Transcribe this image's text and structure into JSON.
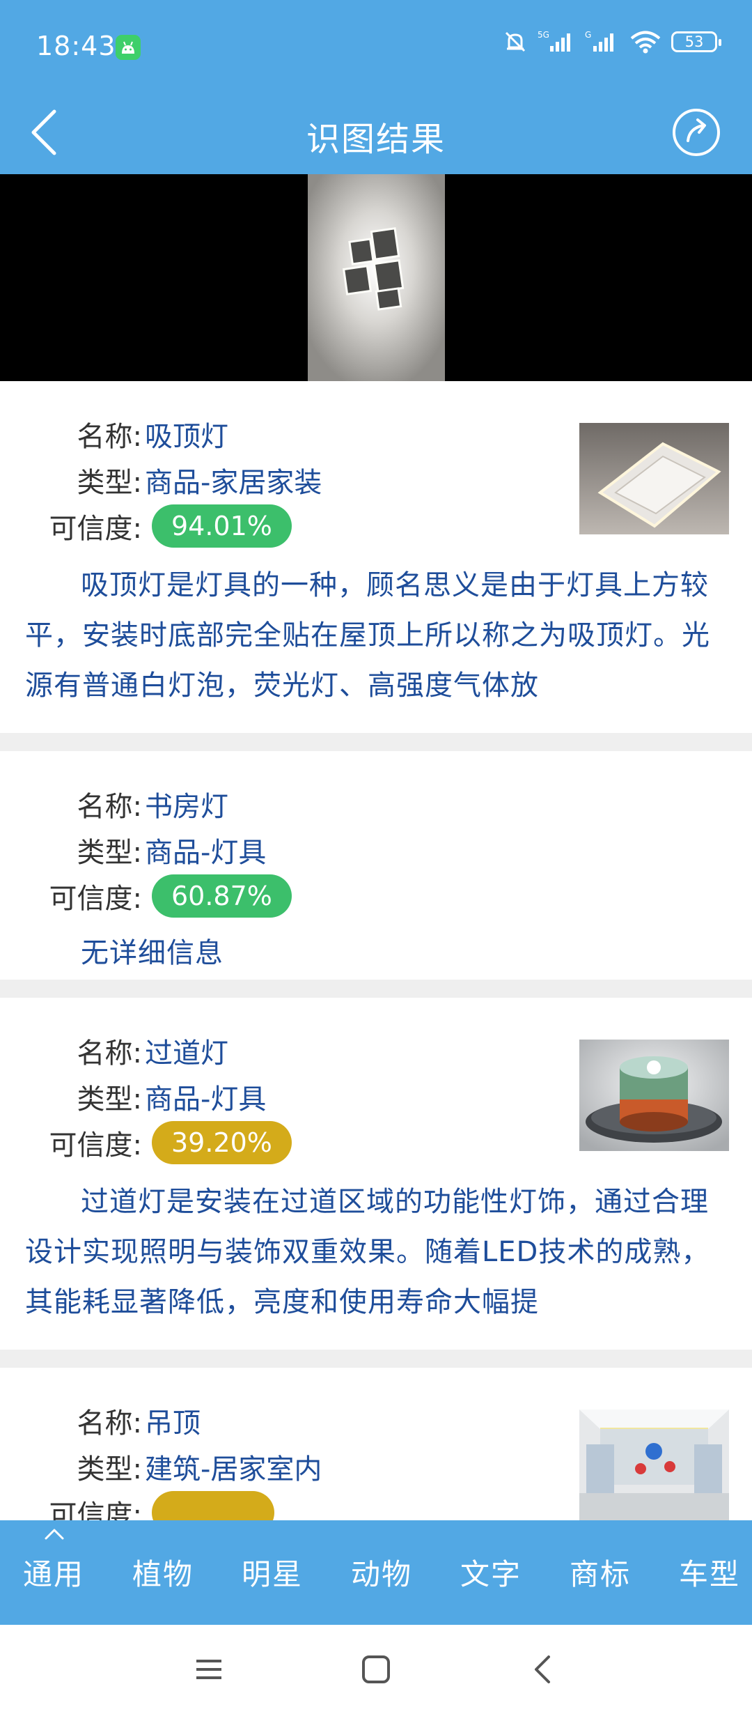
{
  "status_bar": {
    "time": "18:43",
    "battery": "53",
    "icons": [
      "android-app-icon",
      "mute-bell-icon",
      "5g-signal-icon",
      "g-signal-icon",
      "wifi-icon",
      "battery-icon"
    ]
  },
  "app_bar": {
    "title": "识图结果",
    "back_icon": "chevron-left-icon",
    "share_icon": "share-icon"
  },
  "results": [
    {
      "name_label": "名称:",
      "name": "吸顶灯",
      "type_label": "类型:",
      "type": "商品-家居家装",
      "confidence_label": "可信度:",
      "confidence": "94.01%",
      "confidence_color": "#3cbf6b",
      "description": "吸顶灯是灯具的一种，顾名思义是由于灯具上方较平，安装时底部完全贴在屋顶上所以称之为吸顶灯。光源有普通白灯泡，荧光灯、高强度气体放"
    },
    {
      "name_label": "名称:",
      "name": "书房灯",
      "type_label": "类型:",
      "type": "商品-灯具",
      "confidence_label": "可信度:",
      "confidence": "60.87%",
      "confidence_color": "#3cbf6b",
      "description": "无详细信息"
    },
    {
      "name_label": "名称:",
      "name": "过道灯",
      "type_label": "类型:",
      "type": "商品-灯具",
      "confidence_label": "可信度:",
      "confidence": "39.20%",
      "confidence_color": "#d4ab1a",
      "description": "过道灯是安装在过道区域的功能性灯饰，通过合理设计实现照明与装饰双重效果。随着LED技术的成熟，其能耗显著降低，亮度和使用寿命大幅提"
    },
    {
      "name_label": "名称:",
      "name": "吊顶",
      "type_label": "类型:",
      "type": "建筑-居家室内",
      "confidence_label": "可信度:",
      "confidence_color": "#d4ab1a"
    }
  ],
  "tabs": [
    "通用",
    "植物",
    "明星",
    "动物",
    "文字",
    "商标",
    "车型"
  ],
  "nav": [
    "menu-icon",
    "home-square-icon",
    "back-triangle-icon"
  ],
  "colors": {
    "primary": "#52a8e4",
    "text_blue": "#1e4d9a",
    "separator": "#efefef"
  }
}
